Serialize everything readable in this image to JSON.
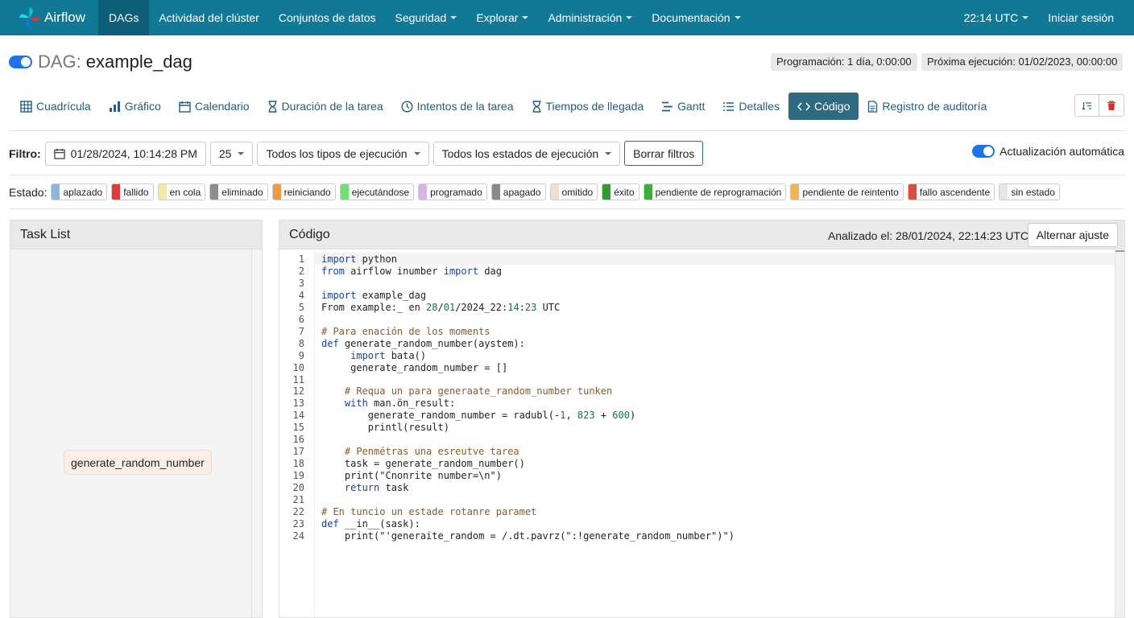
{
  "navbar": {
    "brand": "Airflow",
    "items": [
      {
        "label": "DAGs",
        "active": true,
        "dropdown": false
      },
      {
        "label": "Actividad del clúster",
        "dropdown": false
      },
      {
        "label": "Conjuntos de datos",
        "dropdown": false
      },
      {
        "label": "Seguridad",
        "dropdown": true
      },
      {
        "label": "Explorar",
        "dropdown": true
      },
      {
        "label": "Administración",
        "dropdown": true
      },
      {
        "label": "Documentación",
        "dropdown": true
      }
    ],
    "time": "22:14 UTC",
    "login": "Iniciar sesión"
  },
  "dag": {
    "prefix": "DAG:",
    "name": "example_dag",
    "schedule": "Programación: 1 día, 0:00:00",
    "next_run": "Próxima ejecución: 01/02/2023, 00:00:00"
  },
  "tabs": [
    {
      "label": "Cuadrícula",
      "icon": "grid-icon"
    },
    {
      "label": "Gráfico",
      "icon": "bar-chart-icon"
    },
    {
      "label": "Calendario",
      "icon": "calendar-icon"
    },
    {
      "label": "Duración de la tarea",
      "icon": "hourglass-icon"
    },
    {
      "label": "Intentos de la tarea",
      "icon": "clock-icon"
    },
    {
      "label": "Tiempos de llegada",
      "icon": "hourglass-icon"
    },
    {
      "label": "Gantt",
      "icon": "gantt-icon"
    },
    {
      "label": "Detalles",
      "icon": "list-icon"
    },
    {
      "label": "Código",
      "icon": "code-icon",
      "active": true
    },
    {
      "label": "Registro de auditoría",
      "icon": "document-icon"
    }
  ],
  "filters": {
    "label": "Filtro:",
    "date": "01/28/2024, 10:14:28 PM",
    "count": "25",
    "run_type": "Todos los tipos de ejecución",
    "run_state": "Todos los estados de ejecución",
    "clear": "Borrar filtros",
    "auto_refresh": "Actualización automática"
  },
  "states": {
    "label": "Estado:",
    "items": [
      {
        "label": "aplazado",
        "color": "#8fb5dd"
      },
      {
        "label": "fallido",
        "color": "#e53935"
      },
      {
        "label": "en cola",
        "color": "#f3e9a6"
      },
      {
        "label": "eliminado",
        "color": "#8e8e8e"
      },
      {
        "label": "reiniciando",
        "color": "#f39a3d"
      },
      {
        "label": "ejecutándose",
        "color": "#6fe36f"
      },
      {
        "label": "programado",
        "color": "#d6b6e8"
      },
      {
        "label": "apagado",
        "color": "#8a8a8a"
      },
      {
        "label": "omitido",
        "color": "#f0e0d2"
      },
      {
        "label": "éxito",
        "color": "#2e9e2e"
      },
      {
        "label": "pendiente de reprogramación",
        "color": "#36b336"
      },
      {
        "label": "pendiente de reintento",
        "color": "#f5b24a"
      },
      {
        "label": "fallo ascendente",
        "color": "#e24a3a"
      },
      {
        "label": "sin estado",
        "color": "#e6e6e6"
      }
    ]
  },
  "task_list": {
    "title": "Task List",
    "task": "generate_random_number"
  },
  "code": {
    "title": "Código",
    "parsed_at": "Analizado el: 28/01/2024, 22:14:23 UTC",
    "wrap_button": "Alternar ajuste",
    "lines": [
      "import python",
      "from airflow inumber import dag",
      "",
      "import example_dag",
      "From example:_ en 28/01/2024_22:14:23 UTC",
      "",
      "# Para enación de los moments",
      "def generate_random_number(aystem):",
      "     import bata()",
      "     generate_random_number = []",
      "",
      "    # Requa un para generaate_random_number tunken",
      "    with man.ön_result:",
      "        generate_random_number = radubl(-1, 823 + 600)",
      "        printl(result)",
      "",
      "    # Penmétras una esreutve tarea",
      "    task = generate_random_number()",
      "    print(\"Cnonrite number=\\n\")",
      "    return task",
      "",
      "# En tuncio un estade rotanre paramet",
      "def __in__(sask):",
      "    print(\"'generaite_random = /.dt.pavrz(\":!generate_random_number\")\")"
    ]
  }
}
